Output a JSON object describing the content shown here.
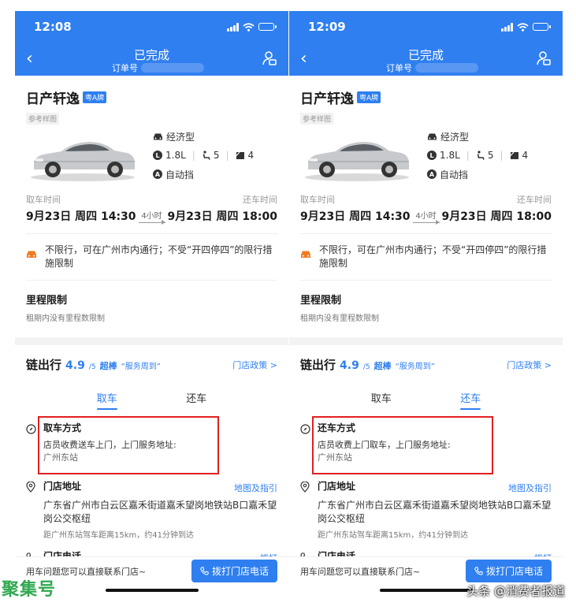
{
  "colors": {
    "brand": "#2f7ff0",
    "highlight_box": "#e02020",
    "watermark_green": "#2fa84f"
  },
  "screens": [
    {
      "time": "12:08",
      "nav_title": "已完成",
      "order_label": "订单号",
      "car_name": "日产轩逸",
      "plate": "粤A牌",
      "sample_label": "参考样图",
      "spec_class": "经济型",
      "displacement": "1.8L",
      "seats": "5",
      "doors": "4",
      "transmission": "自动挡",
      "pickup_time_label": "取车时间",
      "return_time_label": "还车时间",
      "pickup_time": "9月23日 周四 14:30",
      "duration": "4小时",
      "return_time": "9月23日 周四 18:00",
      "notice": "不限行，可在广州市内通行；不受“开四停四”的限行措施限制",
      "mileage_title": "里程限制",
      "mileage_desc": "租期内没有里程数限制",
      "store_name": "链出行",
      "rating": "4.9",
      "rating_of": "/5",
      "praise": "超棒",
      "praise_quote": "“服务周到”",
      "policy": "门店政策 >",
      "tab_pickup": "取车",
      "tab_return": "还车",
      "active_tab": "pickup",
      "method_title": "取车方式",
      "method_desc": "店员收费送车上门，上门服务地址:",
      "method_addr": "广州东站",
      "store_addr_title": "门店地址",
      "map_link": "地图及指引",
      "store_addr": "广东省广州市白云区嘉禾街道嘉禾望岗地铁站B口嘉禾望岗公交枢纽",
      "distance": "距广州东站驾车距离15km，约41分钟到达",
      "store_phone_title": "门店电话",
      "dial": "拨打",
      "bottom_hint": "用车问题您可以直接联系门店~",
      "call_button": "拨打门店电话"
    },
    {
      "time": "12:09",
      "nav_title": "已完成",
      "order_label": "订单号",
      "car_name": "日产轩逸",
      "plate": "粤A牌",
      "sample_label": "参考样图",
      "spec_class": "经济型",
      "displacement": "1.8L",
      "seats": "5",
      "doors": "4",
      "transmission": "自动挡",
      "pickup_time_label": "取车时间",
      "return_time_label": "还车时间",
      "pickup_time": "9月23日 周四 14:30",
      "duration": "4小时",
      "return_time": "9月23日 周四 18:00",
      "notice": "不限行，可在广州市内通行；不受“开四停四”的限行措施限制",
      "mileage_title": "里程限制",
      "mileage_desc": "租期内没有里程数限制",
      "store_name": "链出行",
      "rating": "4.9",
      "rating_of": "/5",
      "praise": "超棒",
      "praise_quote": "“服务周到”",
      "policy": "门店政策 >",
      "tab_pickup": "取车",
      "tab_return": "还车",
      "active_tab": "return",
      "method_title": "还车方式",
      "method_desc": "店员收费上门取车，上门服务地址:",
      "method_addr": "广州东站",
      "store_addr_title": "门店地址",
      "map_link": "地图及指引",
      "store_addr": "广东省广州市白云区嘉禾街道嘉禾望岗地铁站B口嘉禾望岗公交枢纽",
      "distance": "距广州东站驾车距离15km，约41分钟到达",
      "store_phone_title": "门店电话",
      "dial": "拨打",
      "bottom_hint": "用车问题您可以直接联系门店~",
      "call_button": "拨打门店电话"
    }
  ],
  "watermarks": {
    "left": "聚集号",
    "right": "头条 @消费者报道"
  }
}
